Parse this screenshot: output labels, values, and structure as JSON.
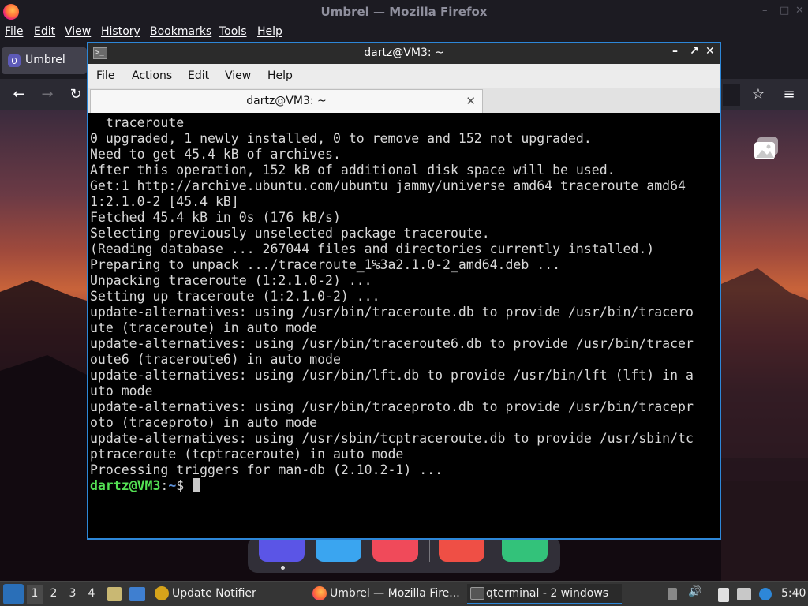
{
  "firefox": {
    "title": "Umbrel — Mozilla Firefox",
    "menu": [
      "File",
      "Edit",
      "View",
      "History",
      "Bookmarks",
      "Tools",
      "Help"
    ],
    "tab_label": "Umbrel",
    "controls": {
      "minimize": "–",
      "maximize": "□",
      "close": "✕"
    },
    "nav": {
      "back": "←",
      "forward": "→",
      "reload": "↻",
      "bookmark": "☆",
      "menu": "≡"
    }
  },
  "terminal": {
    "title": "dartz@VM3: ~",
    "menu": [
      "File",
      "Actions",
      "Edit",
      "View",
      "Help"
    ],
    "tab_label": "dartz@VM3: ~",
    "tab_close": "✕",
    "controls": {
      "minimize": "–",
      "maximize": "↗",
      "close": "✕"
    },
    "output_lines": [
      "  traceroute",
      "0 upgraded, 1 newly installed, 0 to remove and 152 not upgraded.",
      "Need to get 45.4 kB of archives.",
      "After this operation, 152 kB of additional disk space will be used.",
      "Get:1 http://archive.ubuntu.com/ubuntu jammy/universe amd64 traceroute amd64",
      "1:2.1.0-2 [45.4 kB]",
      "Fetched 45.4 kB in 0s (176 kB/s)",
      "Selecting previously unselected package traceroute.",
      "(Reading database ... 267044 files and directories currently installed.)",
      "Preparing to unpack .../traceroute_1%3a2.1.0-2_amd64.deb ...",
      "Unpacking traceroute (1:2.1.0-2) ...",
      "Setting up traceroute (1:2.1.0-2) ...",
      "update-alternatives: using /usr/bin/traceroute.db to provide /usr/bin/tracero",
      "ute (traceroute) in auto mode",
      "update-alternatives: using /usr/bin/traceroute6.db to provide /usr/bin/tracer",
      "oute6 (traceroute6) in auto mode",
      "update-alternatives: using /usr/bin/lft.db to provide /usr/bin/lft (lft) in a",
      "uto mode",
      "update-alternatives: using /usr/bin/traceproto.db to provide /usr/bin/tracepr",
      "oto (traceproto) in auto mode",
      "update-alternatives: using /usr/sbin/tcptraceroute.db to provide /usr/sbin/tc",
      "ptraceroute (tcptraceroute) in auto mode",
      "Processing triggers for man-db (2.10.2-1) ..."
    ],
    "prompt": {
      "user_host": "dartz@VM3",
      "sep": ":",
      "path": "~",
      "symbol": "$ "
    }
  },
  "taskbar": {
    "workspaces": [
      "1",
      "2",
      "3",
      "4"
    ],
    "tasks": [
      {
        "label": "Update Notifier",
        "icon": "update-notifier-icon"
      },
      {
        "label": "Umbrel — Mozilla Fire...",
        "icon": "firefox-icon"
      },
      {
        "label": "qterminal - 2 windows",
        "icon": "terminal-icon"
      }
    ],
    "clock": "5:40"
  },
  "colors": {
    "terminal_border": "#2d87d8",
    "prompt_user": "#54e154",
    "prompt_path": "#5c8fd6"
  }
}
